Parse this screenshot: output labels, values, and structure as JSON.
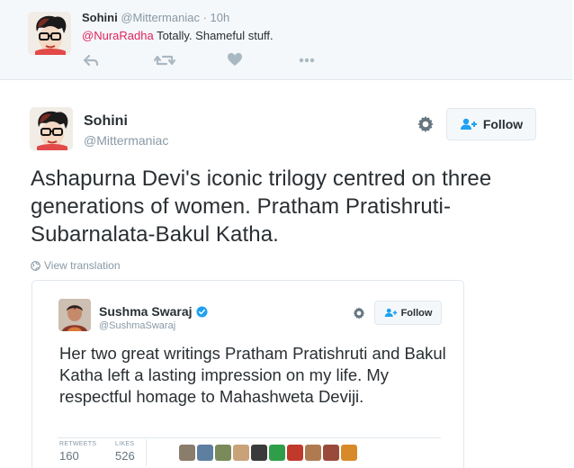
{
  "reply_tweet": {
    "name": "Sohini",
    "handle": "@Mittermaniac",
    "separator": "·",
    "time": "10h",
    "mention": "@NuraRadha",
    "text": " Totally. Shameful stuff.",
    "action_icons": [
      "reply-icon",
      "retweet-icon",
      "like-icon",
      "more-icon"
    ]
  },
  "main_tweet": {
    "name": "Sohini",
    "handle": "@Mittermaniac",
    "follow_label": "Follow",
    "text": "Ashapurna Devi's iconic trilogy centred on three generations of women. Pratham Pratishruti-Subarnalata-Bakul Katha.",
    "translate_label": "View translation"
  },
  "embedded_tweet": {
    "name": "Sushma Swaraj",
    "handle": "@SushmaSwaraj",
    "follow_label": "Follow",
    "text": "Her two great writings Pratham Pratishruti and Bakul Katha left a lasting impression on my life. My respectful homage to Mahashweta Deviji.",
    "retweets_label": "RETWEETS",
    "retweets_count": "160",
    "likes_label": "LIKES",
    "likes_count": "526"
  },
  "colors": {
    "mention": "#e0245e",
    "muted": "#8899a6",
    "text": "#292f33",
    "verified": "#1da1f2",
    "border": "#e1e8ed",
    "reply_bg": "#f5f8fa"
  }
}
